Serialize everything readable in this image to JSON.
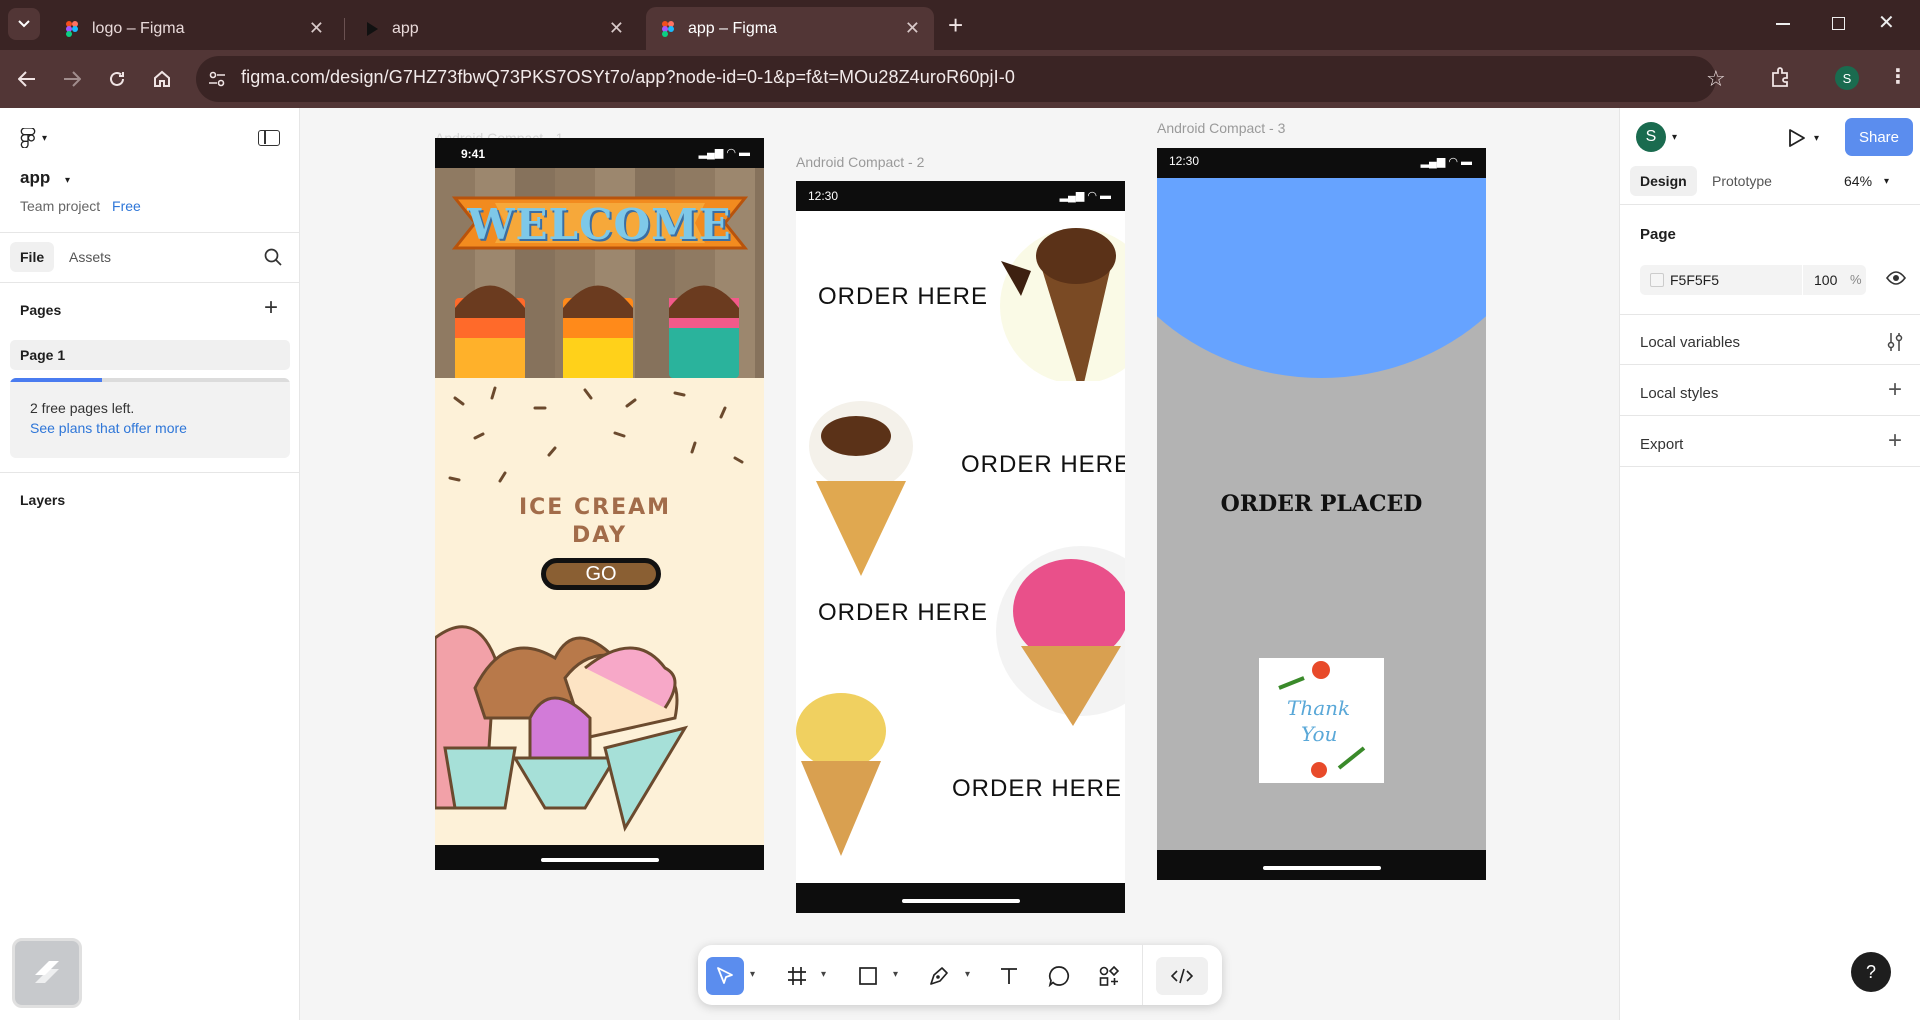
{
  "browser": {
    "tabs": [
      {
        "title": "logo – Figma",
        "active": false
      },
      {
        "title": "app",
        "active": false
      },
      {
        "title": "app – Figma",
        "active": true
      }
    ],
    "url": "figma.com/design/G7HZ73fbwQ73PKS7OSYt7o/app?node-id=0-1&p=f&t=MOu28Z4uroR60pjI-0",
    "profile_initial": "S"
  },
  "left_panel": {
    "file_name": "app",
    "project": "Team project",
    "plan_badge": "Free",
    "tabs": [
      "File",
      "Assets"
    ],
    "pages_title": "Pages",
    "pages": [
      "Page 1"
    ],
    "free_pages_progress": 0.33,
    "free_pages_text": "2 free pages left.",
    "plans_link": "See plans that offer more",
    "layers_title": "Layers"
  },
  "canvas": {
    "frames": [
      {
        "label": "Android Compact - 1",
        "time": "9:41",
        "welcome": "WELCOME",
        "title_line1": "ICE CREAM",
        "title_line2": "DAY",
        "button": "GO"
      },
      {
        "label": "Android Compact - 2",
        "time": "12:30",
        "orders": [
          "ORDER  HERE",
          "ORDER  HERE",
          "ORDER  HERE",
          "ORDER  HERE"
        ]
      },
      {
        "label": "Android Compact - 3",
        "time": "12:30",
        "status_text": "ORDER PLACED",
        "card_line1": "Thank",
        "card_line2": "You"
      }
    ]
  },
  "right_panel": {
    "user_initial": "S",
    "share": "Share",
    "tabs": [
      "Design",
      "Prototype"
    ],
    "zoom": "64%",
    "page_section": "Page",
    "page_color": "F5F5F5",
    "opacity": "100",
    "opacity_unit": "%",
    "sections": [
      "Local variables",
      "Local styles",
      "Export"
    ]
  },
  "help": "?",
  "colors": {
    "accent": "#5b8dee",
    "frame3_blue": "#66a3ff",
    "frame3_gray": "#b3b3b3",
    "ice_bg": "#fdf1d8"
  }
}
